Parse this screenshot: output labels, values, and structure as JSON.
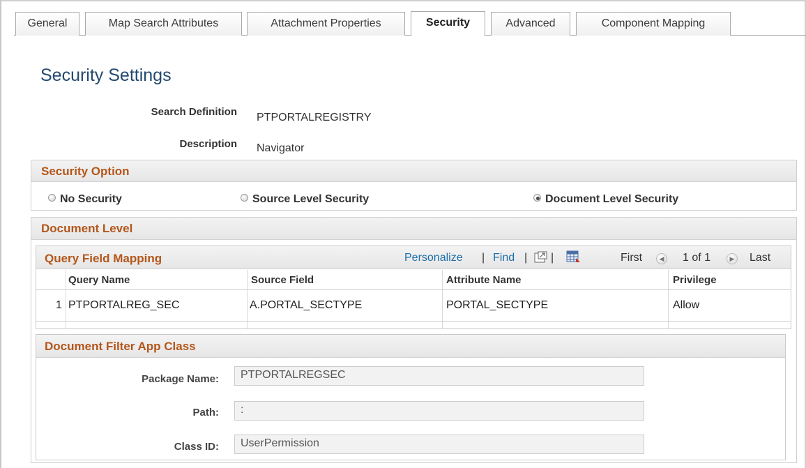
{
  "tabs": [
    {
      "label": "General"
    },
    {
      "label": "Map Search Attributes"
    },
    {
      "label": "Attachment Properties"
    },
    {
      "label": "Security"
    },
    {
      "label": "Advanced"
    },
    {
      "label": "Component Mapping"
    }
  ],
  "active_tab": "Security",
  "page_title": "Security Settings",
  "search_definition": {
    "label": "Search Definition",
    "value": "PTPORTALREGISTRY"
  },
  "description": {
    "label": "Description",
    "value": "Navigator"
  },
  "security_option": {
    "header": "Security Option",
    "options": [
      {
        "label": "No Security",
        "selected": false
      },
      {
        "label": "Source Level Security",
        "selected": false
      },
      {
        "label": "Document Level Security",
        "selected": true
      }
    ]
  },
  "document_level": {
    "header": "Document Level",
    "grid": {
      "title": "Query Field Mapping",
      "toolbar": {
        "personalize": "Personalize",
        "find": "Find",
        "separator": "|",
        "download_icon": "grid-download-icon",
        "zoom_icon": "view-all-icon"
      },
      "nav": {
        "first": "First",
        "range": "1 of 1",
        "last": "Last"
      },
      "columns": [
        "Query Name",
        "Source Field",
        "Attribute Name",
        "Privilege"
      ],
      "rows": [
        {
          "num": "1",
          "query_name": "PTPORTALREG_SEC",
          "source_field": "A.PORTAL_SECTYPE",
          "attribute_name": "PORTAL_SECTYPE",
          "privilege": "Allow"
        }
      ]
    },
    "filter": {
      "header": "Document Filter App Class",
      "package_name": {
        "label": "Package Name:",
        "value": "PTPORTALREGSEC"
      },
      "path": {
        "label": "Path:",
        "value": ":"
      },
      "class_id": {
        "label": "Class ID:",
        "value": "UserPermission"
      }
    }
  },
  "colors": {
    "accent_header": "#b4561a",
    "title": "#24496e",
    "link": "#1d6ea8"
  }
}
